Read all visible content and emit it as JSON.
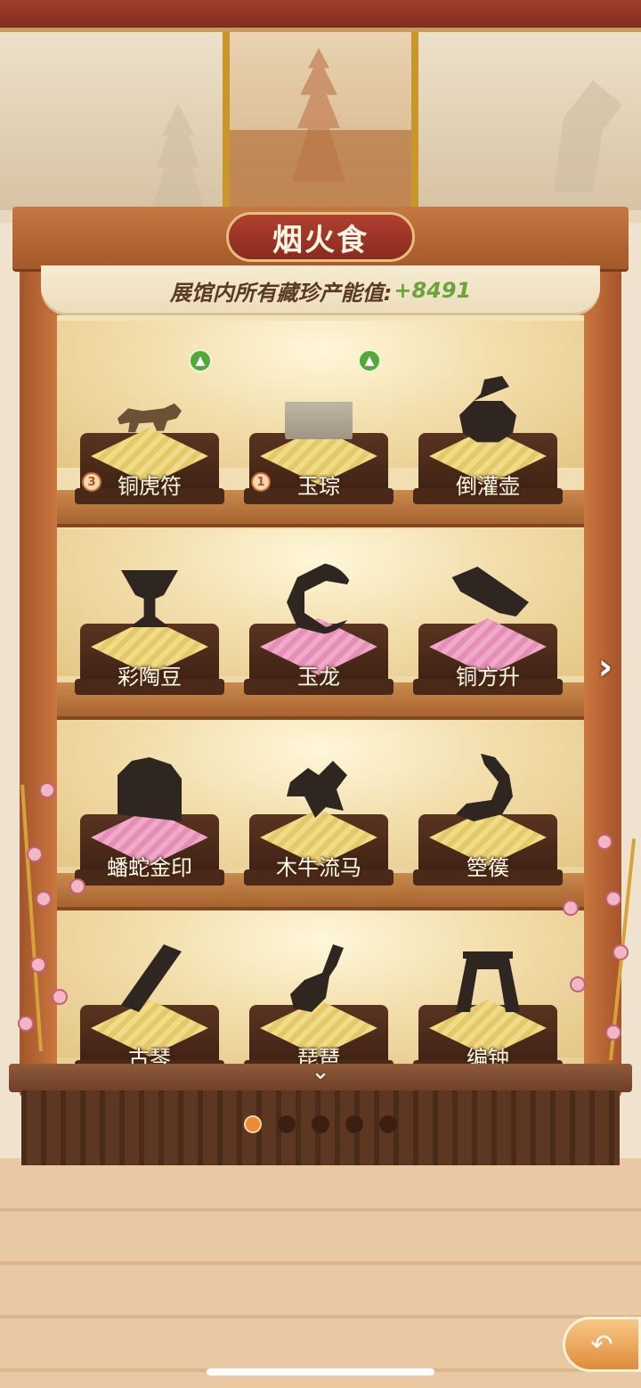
{
  "hall": {
    "title": "烟火食",
    "value_label": "展馆内所有藏珍产能值:",
    "value_number": "+8491"
  },
  "shelves": [
    {
      "items": [
        {
          "name": "铜虎符",
          "level": "3",
          "upgrade": true,
          "cushion": "gold",
          "revealed": true,
          "icon": "tiger-tally-icon"
        },
        {
          "name": "玉琮",
          "level": "1",
          "upgrade": true,
          "cushion": "gold",
          "revealed": true,
          "icon": "jade-cong-icon"
        },
        {
          "name": "倒灌壶",
          "cushion": "gold",
          "revealed": false,
          "icon": "teapot-silhouette-icon"
        }
      ]
    },
    {
      "items": [
        {
          "name": "彩陶豆",
          "cushion": "gold",
          "revealed": false,
          "icon": "pottery-cup-silhouette-icon"
        },
        {
          "name": "玉龙",
          "cushion": "pink",
          "revealed": false,
          "icon": "jade-dragon-silhouette-icon"
        },
        {
          "name": "铜方升",
          "cushion": "pink",
          "revealed": false,
          "icon": "bronze-measure-silhouette-icon"
        }
      ]
    },
    {
      "items": [
        {
          "name": "蟠蛇金印",
          "cushion": "pink",
          "revealed": false,
          "icon": "gold-seal-silhouette-icon"
        },
        {
          "name": "木牛流马",
          "cushion": "gold",
          "revealed": false,
          "icon": "wooden-ox-silhouette-icon"
        },
        {
          "name": "箜篌",
          "cushion": "gold",
          "revealed": false,
          "icon": "harp-silhouette-icon"
        }
      ]
    },
    {
      "items": [
        {
          "name": "古琴",
          "cushion": "gold",
          "revealed": false,
          "icon": "guqin-silhouette-icon"
        },
        {
          "name": "琵琶",
          "cushion": "gold",
          "revealed": false,
          "icon": "pipa-silhouette-icon"
        },
        {
          "name": "编钟",
          "cushion": "gold",
          "revealed": false,
          "icon": "bianzhong-silhouette-icon"
        }
      ]
    }
  ],
  "pagination": {
    "total": 5,
    "current": 1
  },
  "controls": {
    "next_icon": "chevron-right-icon",
    "scroll_icon": "chevron-down-icon",
    "back_icon": "back-arrow-icon"
  },
  "colors": {
    "title_plate": "#9a3124",
    "value_green": "#6aa43b",
    "active_dot": "#ef8a34",
    "cushion_gold": "#e9d27a",
    "cushion_pink": "#ec9fc1"
  }
}
